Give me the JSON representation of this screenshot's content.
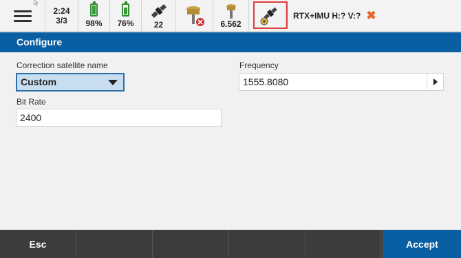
{
  "status_bar": {
    "time": "2:24",
    "pages": "3/3",
    "battery_1": {
      "label": "98%",
      "level": 0.98
    },
    "battery_2": {
      "label": "76%",
      "level": 0.76
    },
    "satellites": "22",
    "receiver_value": "6.562",
    "position_status": "RTX+IMU H:? V:?",
    "icons": {
      "menu": "hamburger-menu-icon",
      "sat": "satellite-icon",
      "rcv_error": "gnss-receiver-error-icon",
      "rcv": "gnss-receiver-icon",
      "rtx": "rtx-satellite-icon",
      "close": "close-x-icon"
    },
    "colors": {
      "battery": "#3a9a3a",
      "error": "#e03c3c",
      "x_mark": "#e8632c"
    }
  },
  "title": "Configure",
  "form": {
    "correction_satellite_label": "Correction satellite name",
    "correction_satellite_value": "Custom",
    "frequency_label": "Frequency",
    "frequency_value": "1555.8080",
    "bit_rate_label": "Bit Rate",
    "bit_rate_value": "2400"
  },
  "bottom_bar": {
    "esc": "Esc",
    "accept": "Accept"
  },
  "colors": {
    "title_bar": "#0a5fa3",
    "accept_button": "#0a5fa3",
    "bottom_bar": "#3c3c3c"
  }
}
